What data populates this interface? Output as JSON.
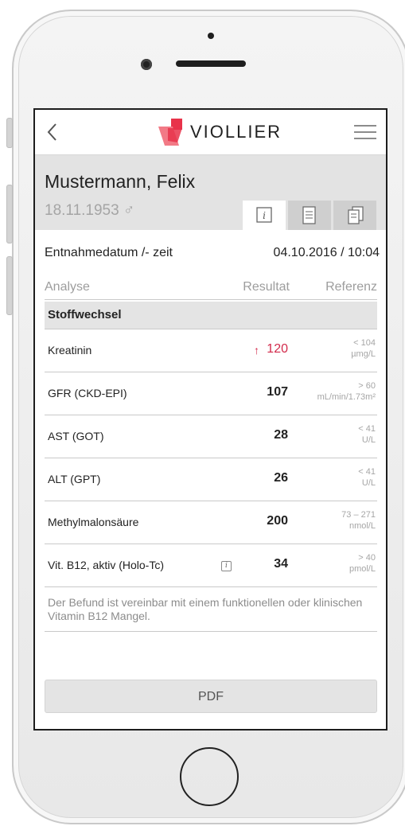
{
  "app": {
    "logo_text": "VIOLLIER"
  },
  "patient": {
    "name": "Mustermann, Felix",
    "dob": "18.11.1953 ♂"
  },
  "tabs": [
    {
      "icon": "info-icon",
      "active": true
    },
    {
      "icon": "document-icon",
      "active": false
    },
    {
      "icon": "documents-stack-icon",
      "active": false
    }
  ],
  "datum": {
    "label": "Entnahmedatum /- zeit",
    "value": "04.10.2016 / 10:04"
  },
  "columns": {
    "analyse": "Analyse",
    "resultat": "Resultat",
    "referenz": "Referenz"
  },
  "section": "Stoffwechsel",
  "rows": [
    {
      "label": "Kreatinin",
      "flag": "↑",
      "value": "120",
      "ref1": "< 104",
      "ref2": "µmg/L"
    },
    {
      "label": "GFR (CKD-EPI)",
      "value": "107",
      "ref1": "> 60",
      "ref2": "mL/min/1.73m²"
    },
    {
      "label": "AST (GOT)",
      "value": "28",
      "ref1": "< 41",
      "ref2": "U/L"
    },
    {
      "label": "ALT (GPT)",
      "value": "26",
      "ref1": "< 41",
      "ref2": "U/L"
    },
    {
      "label": "Methylmalonsäure",
      "value": "200",
      "ref1": "73 – 271",
      "ref2": "nmol/L"
    },
    {
      "label": "Vit. B12, aktiv (Holo-Tc)",
      "value": "34",
      "ref1": "> 40",
      "ref2": "pmol/L",
      "info": "i"
    }
  ],
  "note": "Der Befund ist vereinbar mit einem funktionellen oder klinischen Vitamin B12 Mangel.",
  "pdf_button": "PDF",
  "colors": {
    "alert": "#d22a4b",
    "brand_red": "#e8334a"
  }
}
